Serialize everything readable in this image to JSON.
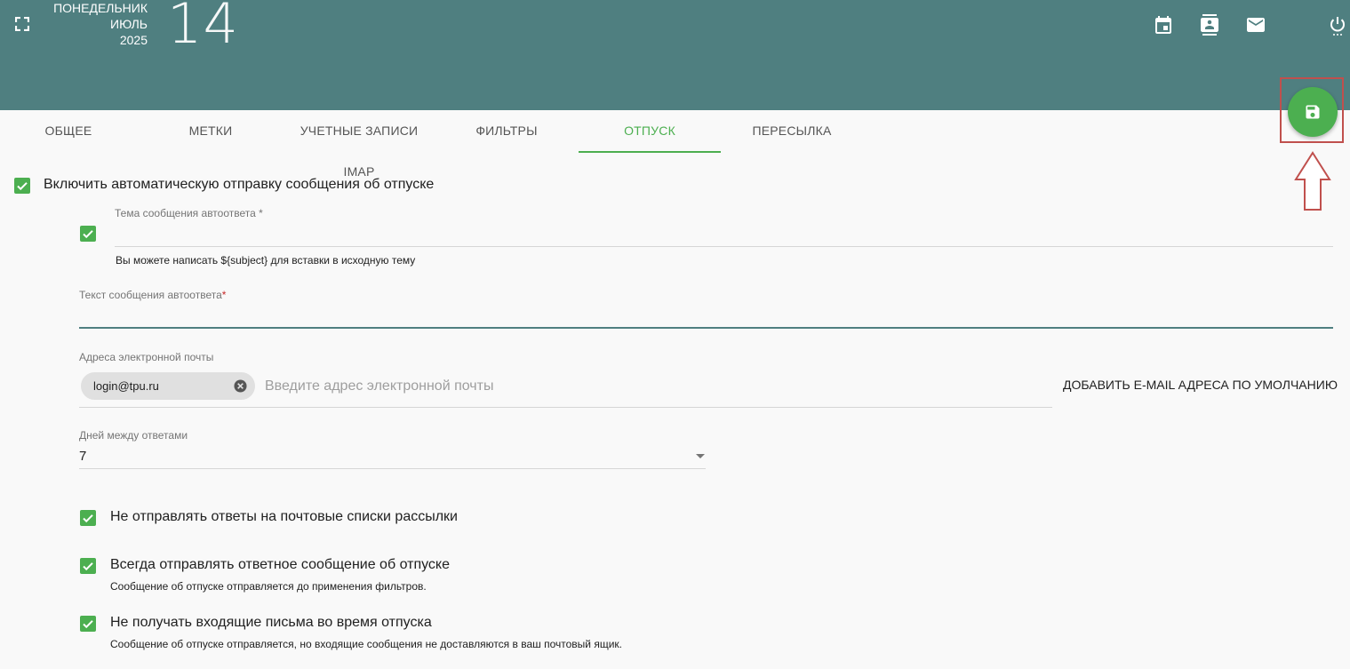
{
  "colors": {
    "header": "#4f7f80",
    "accent": "#4caf50",
    "annotation": "#c0504d"
  },
  "header": {
    "weekday": "ПОНЕДЕЛЬНИК",
    "month": "ИЮЛЬ",
    "year": "2025",
    "day": "14",
    "icons": [
      "fullscreen-icon",
      "calendar-icon",
      "contacts-icon",
      "mail-icon",
      "power-icon"
    ]
  },
  "tabs": [
    {
      "label": "ОБЩЕЕ"
    },
    {
      "label": "МЕТКИ"
    },
    {
      "label": "УЧЕТНЫЕ ЗАПИСИ IMAP"
    },
    {
      "label": "ФИЛЬТРЫ"
    },
    {
      "label": "ОТПУСК",
      "active": true
    },
    {
      "label": "ПЕРЕСЫЛКА"
    }
  ],
  "save_button_icon": "save-icon",
  "vacation": {
    "enable_label": "Включить автоматическую отправку сообщения об отпуске",
    "subject": {
      "label": "Тема сообщения автоответа",
      "required_mark": "*",
      "value": "",
      "hint": "Вы можете написать ${subject} для вставки в исходную тему"
    },
    "body": {
      "label": "Текст сообщения автоответа",
      "required_mark": "*",
      "value": ""
    },
    "addresses": {
      "label": "Адреса электронной почты",
      "chips": [
        "login@tpu.ru"
      ],
      "placeholder": "Введите адрес электронной почты",
      "add_default_button": "ДОБАВИТЬ E-MAIL АДРЕСА ПО УМОЛЧАНИЮ"
    },
    "days": {
      "label": "Дней между ответами",
      "value": "7"
    },
    "options": [
      {
        "label": "Не отправлять ответы на почтовые списки рассылки",
        "checked": true,
        "hint": ""
      },
      {
        "label": "Всегда отправлять ответное сообщение об отпуске",
        "checked": true,
        "hint": "Сообщение об отпуске отправляется до применения фильтров."
      },
      {
        "label": "Не получать входящие письма во время отпуска",
        "checked": true,
        "hint": "Сообщение об отпуске отправляется, но входящие сообщения не доставляются в ваш почтовый ящик."
      }
    ]
  }
}
